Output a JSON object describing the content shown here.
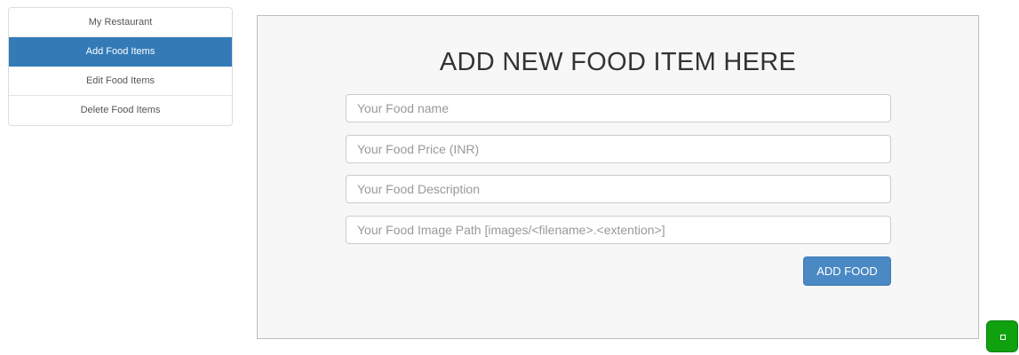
{
  "sidebar": {
    "items": [
      {
        "label": "My Restaurant",
        "active": false
      },
      {
        "label": "Add Food Items",
        "active": true
      },
      {
        "label": "Edit Food Items",
        "active": false
      },
      {
        "label": "Delete Food Items",
        "active": false
      }
    ]
  },
  "form": {
    "title": "ADD NEW FOOD ITEM HERE",
    "fields": {
      "name": {
        "value": "",
        "placeholder": "Your Food name"
      },
      "price": {
        "value": "",
        "placeholder": "Your Food Price (INR)"
      },
      "description": {
        "value": "",
        "placeholder": "Your Food Description"
      },
      "image_path": {
        "value": "",
        "placeholder": "Your Food Image Path [images/<filename>.<extention>]"
      }
    },
    "submit_label": "ADD FOOD"
  },
  "colors": {
    "accent": "#337ab7",
    "button": "#4a89c3",
    "widget": "#10a10e"
  },
  "widget": {
    "icon": "square-icon"
  }
}
